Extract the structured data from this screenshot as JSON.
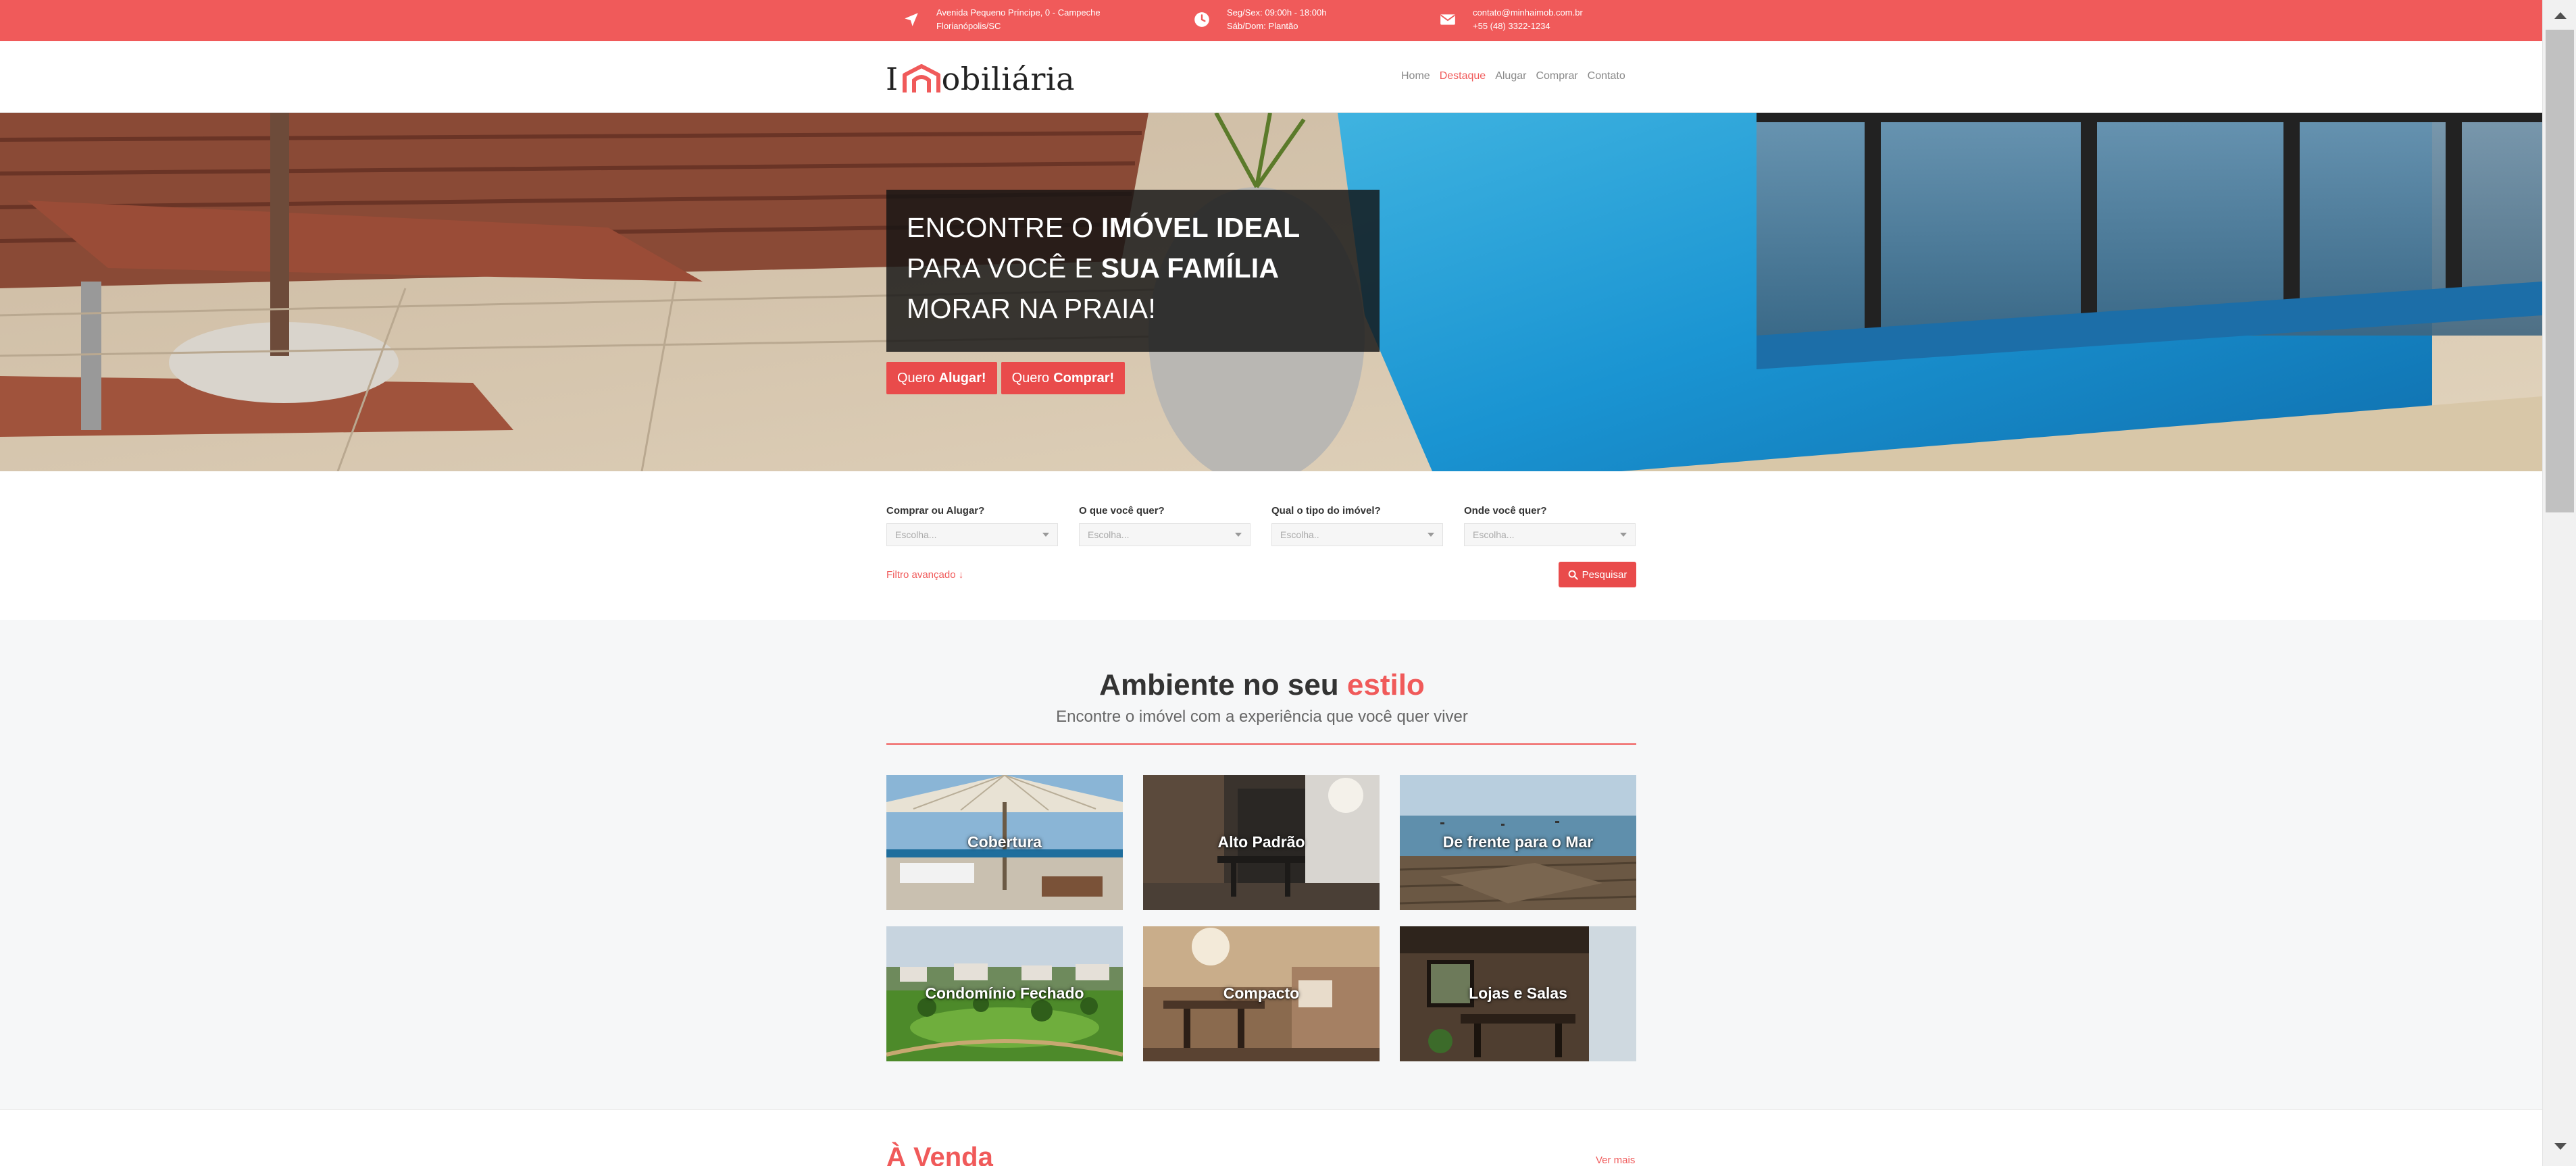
{
  "topbar": {
    "address_line1": "Avenida Pequeno Príncipe, 0 - Campeche",
    "address_line2": "Florianópolis/SC",
    "hours_line1": "Seg/Sex: 09:00h - 18:00h",
    "hours_line2": "Sáb/Dom: Plantão",
    "email": "contato@minhaimob.com.br",
    "phone": "+55 (48) 3322-1234",
    "icons": [
      "location-arrow-icon",
      "clock-icon",
      "envelope-icon"
    ]
  },
  "header": {
    "logo_left": "I",
    "logo_right": "obiliária",
    "nav": [
      {
        "label": "Home",
        "active": false
      },
      {
        "label": "Destaque",
        "active": true
      },
      {
        "label": "Alugar",
        "active": false
      },
      {
        "label": "Comprar",
        "active": false
      },
      {
        "label": "Contato",
        "active": false
      }
    ]
  },
  "hero": {
    "t1": "ENCONTRE O ",
    "t2": "IMÓVEL IDEAL",
    "t3": " PARA VOCÊ E ",
    "t4": "SUA FAMÍLIA",
    "t5": " MORAR NA PRAIA!",
    "rent_pre": "Quero",
    "rent_bold": "Alugar!",
    "buy_pre": "Quero",
    "buy_bold": "Comprar!"
  },
  "search": {
    "fields": [
      {
        "label": "Comprar ou Alugar?",
        "value": "Escolha..."
      },
      {
        "label": "O que você quer?",
        "value": "Escolha..."
      },
      {
        "label": "Qual o tipo do imóvel?",
        "value": "Escolha.."
      },
      {
        "label": "Onde você quer?",
        "value": "Escolha..."
      }
    ],
    "advanced": "Filtro avançado ↓",
    "button": "Pesquisar",
    "button_icon": "search-icon"
  },
  "styles": {
    "title_main": "Ambiente no seu ",
    "title_accent": "estilo",
    "subtitle": "Encontre o imóvel com a experiência que você quer viver",
    "tiles": [
      {
        "label": "Cobertura"
      },
      {
        "label": "Alto Padrão"
      },
      {
        "label": "De frente para o Mar"
      },
      {
        "label": "Condomínio Fechado"
      },
      {
        "label": "Compacto"
      },
      {
        "label": "Lojas e Salas"
      }
    ]
  },
  "sale": {
    "title": "À Venda",
    "see_more": "Ver mais"
  },
  "colors": {
    "accent": "#f05a5a",
    "button": "#e94b4b",
    "section_bg": "#f6f7f8"
  }
}
